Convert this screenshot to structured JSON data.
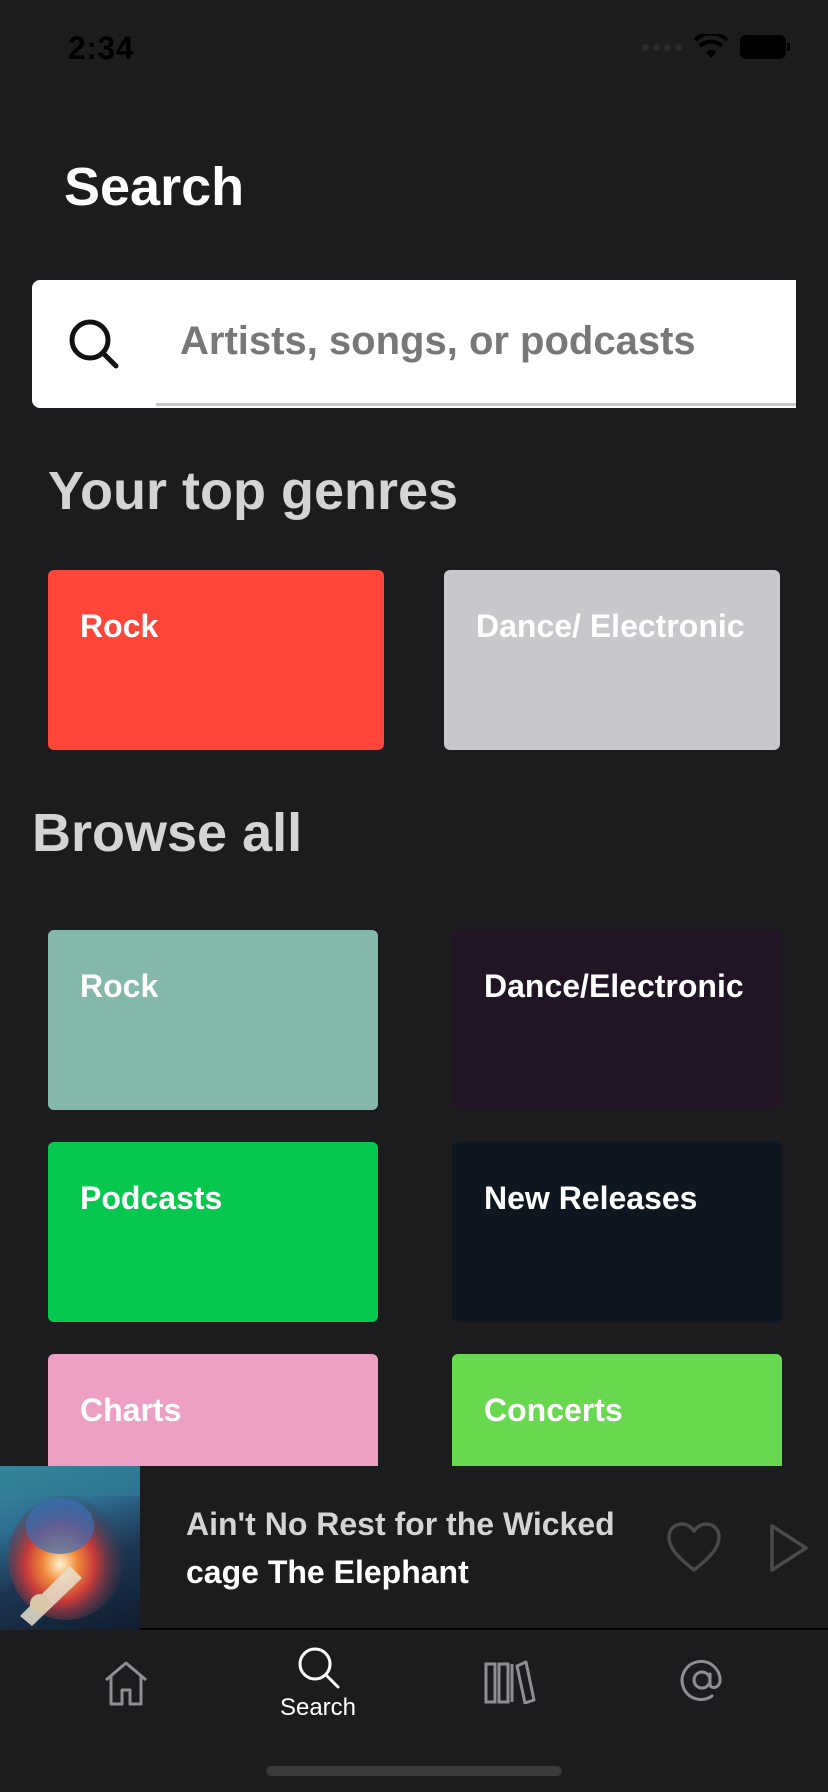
{
  "status_bar": {
    "time": "2:34"
  },
  "header": {
    "title": "Search"
  },
  "search": {
    "placeholder": "Artists, songs, or podcasts"
  },
  "top_genres": {
    "title": "Your top genres",
    "items": [
      {
        "label": "Rock",
        "color": "#ff4638"
      },
      {
        "label": "Dance/ Electronic",
        "color": "#c8c7cc"
      }
    ]
  },
  "browse_all": {
    "title": "Browse all",
    "items": [
      {
        "label": "Rock",
        "color": "#84b8ab"
      },
      {
        "label": "Dance/Electronic",
        "color": "#201425"
      },
      {
        "label": "Podcasts",
        "color": "#06c84e"
      },
      {
        "label": "New Releases",
        "color": "#0e1620"
      },
      {
        "label": "Charts",
        "color": "#eda0c4"
      },
      {
        "label": "Concerts",
        "color": "#68d94f"
      }
    ]
  },
  "now_playing": {
    "track": "Ain't No Rest for the Wicked",
    "artist": "cage The Elephant"
  },
  "tab_bar": {
    "tabs": [
      {
        "icon": "home-icon",
        "label": ""
      },
      {
        "icon": "search-icon",
        "label": "Search"
      },
      {
        "icon": "library-icon",
        "label": ""
      },
      {
        "icon": "at-icon",
        "label": ""
      }
    ]
  }
}
